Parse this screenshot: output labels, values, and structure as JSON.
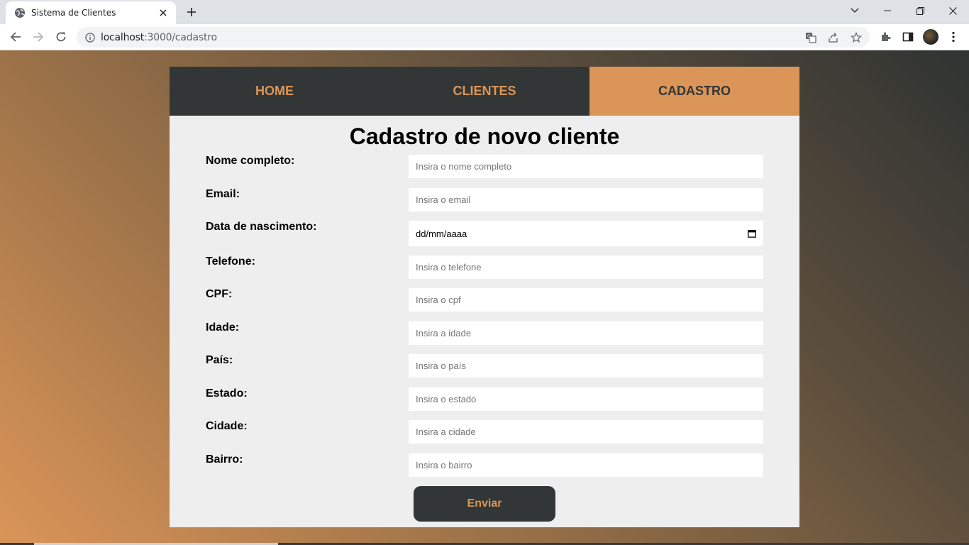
{
  "browser": {
    "tab_title": "Sistema de Clientes",
    "url_host": "localhost",
    "url_path": ":3000/cadastro"
  },
  "nav": {
    "items": [
      {
        "label": "HOME",
        "active": false
      },
      {
        "label": "CLIENTES",
        "active": false
      },
      {
        "label": "CADASTRO",
        "active": true
      }
    ]
  },
  "form": {
    "title": "Cadastro de novo cliente",
    "fields": [
      {
        "label": "Nome completo:",
        "placeholder": "Insira o nome completo",
        "type": "text"
      },
      {
        "label": "Email:",
        "placeholder": "Insira o email",
        "type": "text"
      },
      {
        "label": "Data de nascimento:",
        "value": "dd/mm/aaaa",
        "type": "date"
      },
      {
        "label": "Telefone:",
        "placeholder": "Insira o telefone",
        "type": "text"
      },
      {
        "label": "CPF:",
        "placeholder": "Insira o cpf",
        "type": "text"
      },
      {
        "label": "Idade:",
        "placeholder": "Insira a idade",
        "type": "text"
      },
      {
        "label": "País:",
        "placeholder": "Insira o país",
        "type": "text"
      },
      {
        "label": "Estado:",
        "placeholder": "Insira o estado",
        "type": "text"
      },
      {
        "label": "Cidade:",
        "placeholder": "Insira a cidade",
        "type": "text"
      },
      {
        "label": "Bairro:",
        "placeholder": "Insira o bairro",
        "type": "text"
      }
    ],
    "submit_label": "Enviar"
  },
  "colors": {
    "accent": "#db9558",
    "dark": "#323636",
    "card_bg": "#eeeeee"
  },
  "icons": [
    "globe-icon",
    "close-icon",
    "plus-icon",
    "chevron-down-icon",
    "minimize-icon",
    "restore-icon",
    "window-close-icon",
    "back-arrow-icon",
    "forward-arrow-icon",
    "reload-icon",
    "site-info-icon",
    "translate-icon",
    "share-icon",
    "star-icon",
    "extensions-icon",
    "side-panel-icon",
    "kebab-menu-icon",
    "calendar-icon"
  ]
}
